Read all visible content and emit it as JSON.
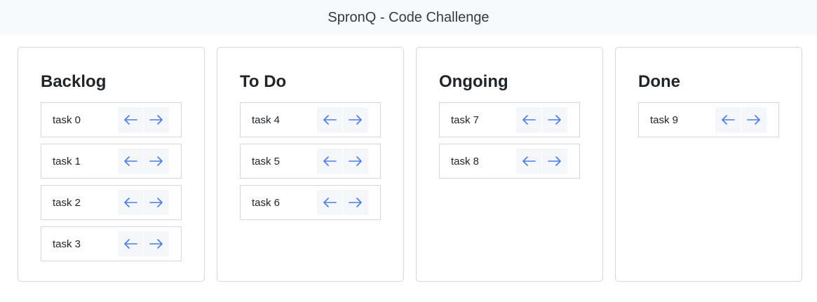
{
  "header": {
    "title": "SpronQ - Code Challenge"
  },
  "colors": {
    "arrow": "#4a7ee8",
    "header_bg": "#f8f9fa",
    "border": "#d7d7d7"
  },
  "icons": {
    "left": "arrow-left-icon",
    "right": "arrow-right-icon"
  },
  "columns": [
    {
      "title": "Backlog",
      "tasks": [
        "task 0",
        "task 1",
        "task 2",
        "task 3"
      ]
    },
    {
      "title": "To Do",
      "tasks": [
        "task 4",
        "task 5",
        "task 6"
      ]
    },
    {
      "title": "Ongoing",
      "tasks": [
        "task 7",
        "task 8"
      ]
    },
    {
      "title": "Done",
      "tasks": [
        "task 9"
      ]
    }
  ]
}
